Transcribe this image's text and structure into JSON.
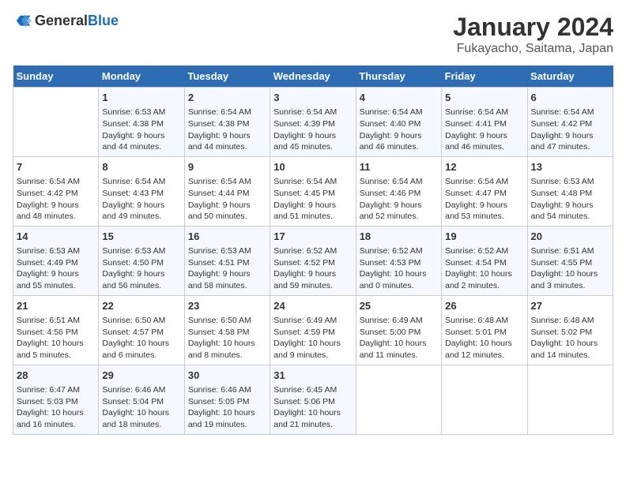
{
  "logo": {
    "general": "General",
    "blue": "Blue"
  },
  "title": "January 2024",
  "subtitle": "Fukayacho, Saitama, Japan",
  "headers": [
    "Sunday",
    "Monday",
    "Tuesday",
    "Wednesday",
    "Thursday",
    "Friday",
    "Saturday"
  ],
  "weeks": [
    [
      {
        "day": "",
        "info": ""
      },
      {
        "day": "1",
        "info": "Sunrise: 6:53 AM\nSunset: 4:38 PM\nDaylight: 9 hours\nand 44 minutes."
      },
      {
        "day": "2",
        "info": "Sunrise: 6:54 AM\nSunset: 4:38 PM\nDaylight: 9 hours\nand 44 minutes."
      },
      {
        "day": "3",
        "info": "Sunrise: 6:54 AM\nSunset: 4:39 PM\nDaylight: 9 hours\nand 45 minutes."
      },
      {
        "day": "4",
        "info": "Sunrise: 6:54 AM\nSunset: 4:40 PM\nDaylight: 9 hours\nand 46 minutes."
      },
      {
        "day": "5",
        "info": "Sunrise: 6:54 AM\nSunset: 4:41 PM\nDaylight: 9 hours\nand 46 minutes."
      },
      {
        "day": "6",
        "info": "Sunrise: 6:54 AM\nSunset: 4:42 PM\nDaylight: 9 hours\nand 47 minutes."
      }
    ],
    [
      {
        "day": "7",
        "info": "Sunrise: 6:54 AM\nSunset: 4:42 PM\nDaylight: 9 hours\nand 48 minutes."
      },
      {
        "day": "8",
        "info": "Sunrise: 6:54 AM\nSunset: 4:43 PM\nDaylight: 9 hours\nand 49 minutes."
      },
      {
        "day": "9",
        "info": "Sunrise: 6:54 AM\nSunset: 4:44 PM\nDaylight: 9 hours\nand 50 minutes."
      },
      {
        "day": "10",
        "info": "Sunrise: 6:54 AM\nSunset: 4:45 PM\nDaylight: 9 hours\nand 51 minutes."
      },
      {
        "day": "11",
        "info": "Sunrise: 6:54 AM\nSunset: 4:46 PM\nDaylight: 9 hours\nand 52 minutes."
      },
      {
        "day": "12",
        "info": "Sunrise: 6:54 AM\nSunset: 4:47 PM\nDaylight: 9 hours\nand 53 minutes."
      },
      {
        "day": "13",
        "info": "Sunrise: 6:53 AM\nSunset: 4:48 PM\nDaylight: 9 hours\nand 54 minutes."
      }
    ],
    [
      {
        "day": "14",
        "info": "Sunrise: 6:53 AM\nSunset: 4:49 PM\nDaylight: 9 hours\nand 55 minutes."
      },
      {
        "day": "15",
        "info": "Sunrise: 6:53 AM\nSunset: 4:50 PM\nDaylight: 9 hours\nand 56 minutes."
      },
      {
        "day": "16",
        "info": "Sunrise: 6:53 AM\nSunset: 4:51 PM\nDaylight: 9 hours\nand 58 minutes."
      },
      {
        "day": "17",
        "info": "Sunrise: 6:52 AM\nSunset: 4:52 PM\nDaylight: 9 hours\nand 59 minutes."
      },
      {
        "day": "18",
        "info": "Sunrise: 6:52 AM\nSunset: 4:53 PM\nDaylight: 10 hours\nand 0 minutes."
      },
      {
        "day": "19",
        "info": "Sunrise: 6:52 AM\nSunset: 4:54 PM\nDaylight: 10 hours\nand 2 minutes."
      },
      {
        "day": "20",
        "info": "Sunrise: 6:51 AM\nSunset: 4:55 PM\nDaylight: 10 hours\nand 3 minutes."
      }
    ],
    [
      {
        "day": "21",
        "info": "Sunrise: 6:51 AM\nSunset: 4:56 PM\nDaylight: 10 hours\nand 5 minutes."
      },
      {
        "day": "22",
        "info": "Sunrise: 6:50 AM\nSunset: 4:57 PM\nDaylight: 10 hours\nand 6 minutes."
      },
      {
        "day": "23",
        "info": "Sunrise: 6:50 AM\nSunset: 4:58 PM\nDaylight: 10 hours\nand 8 minutes."
      },
      {
        "day": "24",
        "info": "Sunrise: 6:49 AM\nSunset: 4:59 PM\nDaylight: 10 hours\nand 9 minutes."
      },
      {
        "day": "25",
        "info": "Sunrise: 6:49 AM\nSunset: 5:00 PM\nDaylight: 10 hours\nand 11 minutes."
      },
      {
        "day": "26",
        "info": "Sunrise: 6:48 AM\nSunset: 5:01 PM\nDaylight: 10 hours\nand 12 minutes."
      },
      {
        "day": "27",
        "info": "Sunrise: 6:48 AM\nSunset: 5:02 PM\nDaylight: 10 hours\nand 14 minutes."
      }
    ],
    [
      {
        "day": "28",
        "info": "Sunrise: 6:47 AM\nSunset: 5:03 PM\nDaylight: 10 hours\nand 16 minutes."
      },
      {
        "day": "29",
        "info": "Sunrise: 6:46 AM\nSunset: 5:04 PM\nDaylight: 10 hours\nand 18 minutes."
      },
      {
        "day": "30",
        "info": "Sunrise: 6:46 AM\nSunset: 5:05 PM\nDaylight: 10 hours\nand 19 minutes."
      },
      {
        "day": "31",
        "info": "Sunrise: 6:45 AM\nSunset: 5:06 PM\nDaylight: 10 hours\nand 21 minutes."
      },
      {
        "day": "",
        "info": ""
      },
      {
        "day": "",
        "info": ""
      },
      {
        "day": "",
        "info": ""
      }
    ]
  ]
}
